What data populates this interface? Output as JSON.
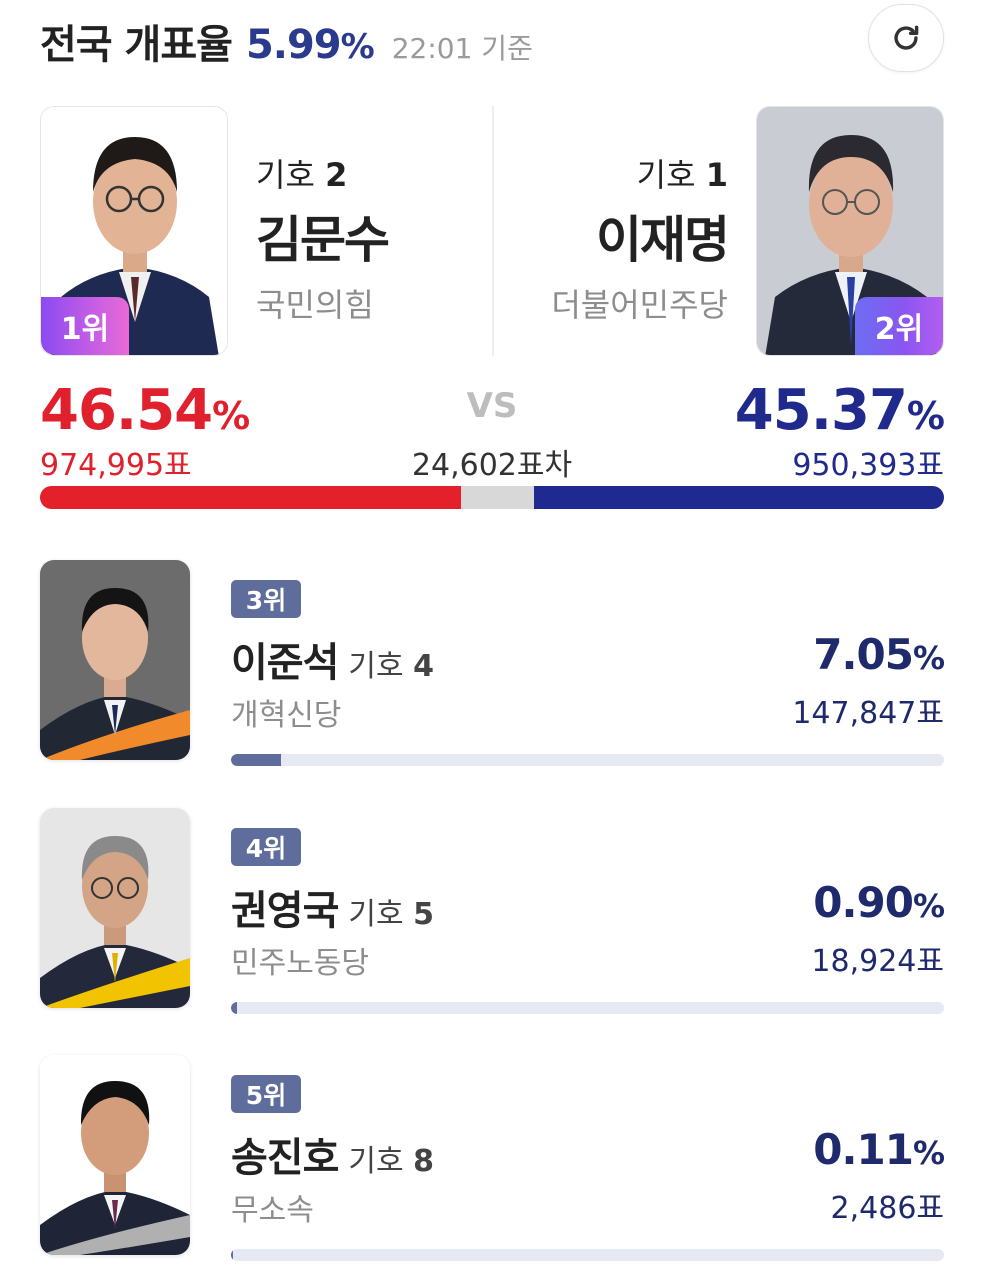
{
  "header": {
    "title": "전국 개표율",
    "rate": "5.99",
    "pct": "%",
    "time": "22:01 기준"
  },
  "top": {
    "left": {
      "rank": "1위",
      "number_label": "기호",
      "number": "2",
      "name": "김문수",
      "party": "국민의힘",
      "percent": "46.54",
      "votes": "974,995표",
      "share": 0.4654
    },
    "right": {
      "rank": "2위",
      "number_label": "기호",
      "number": "1",
      "name": "이재명",
      "party": "더불어민주당",
      "percent": "45.37",
      "votes": "950,393표",
      "share": 0.4537
    },
    "vs": "VS",
    "difference": "24,602표차",
    "pct": "%"
  },
  "others": [
    {
      "rank": "3위",
      "name": "이준석",
      "number_label": "기호",
      "number": "4",
      "party": "개혁신당",
      "percent": "7.05",
      "votes": "147,847표",
      "share": 0.0705
    },
    {
      "rank": "4위",
      "name": "권영국",
      "number_label": "기호",
      "number": "5",
      "party": "민주노동당",
      "percent": "0.90",
      "votes": "18,924표",
      "share": 0.009
    },
    {
      "rank": "5위",
      "name": "송진호",
      "number_label": "기호",
      "number": "8",
      "party": "무소속",
      "percent": "0.11",
      "votes": "2,486표",
      "share": 0.0011
    }
  ],
  "colors": {
    "red": "#e4202a",
    "blue": "#1e2a8f",
    "navy_text": "#1f2a6c",
    "badge": "#5e6d9c",
    "left_frame": "#e86ad7",
    "row_frames": [
      "#f08a2a",
      "#f2c300",
      "#b0b0b0"
    ]
  },
  "icons": {
    "refresh": "refresh-icon"
  }
}
